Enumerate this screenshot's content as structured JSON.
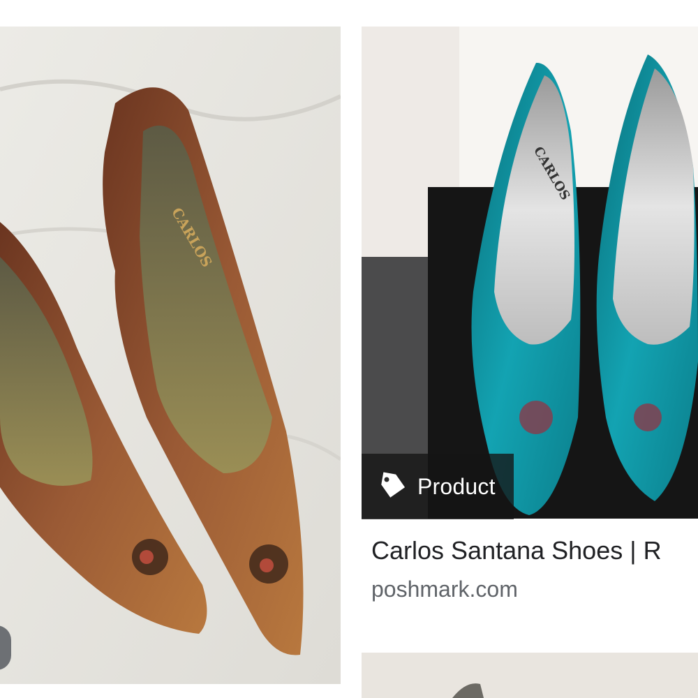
{
  "results": [
    {
      "image_alt": "Bronze pointed-toe Carlos pumps on white blanket",
      "insole_brand": "CARLOS"
    },
    {
      "badge": {
        "icon": "tag-icon",
        "label": "Product"
      },
      "title": "Carlos Santana Shoes | R",
      "source": "poshmark.com",
      "insole_brand": "CARLOS"
    }
  ],
  "colors": {
    "badge_bg": "#141414",
    "title": "#202124",
    "source": "#5f6368",
    "shoe_teal": "#0f9aa8",
    "shoe_bronze": "#8a4a2a"
  }
}
